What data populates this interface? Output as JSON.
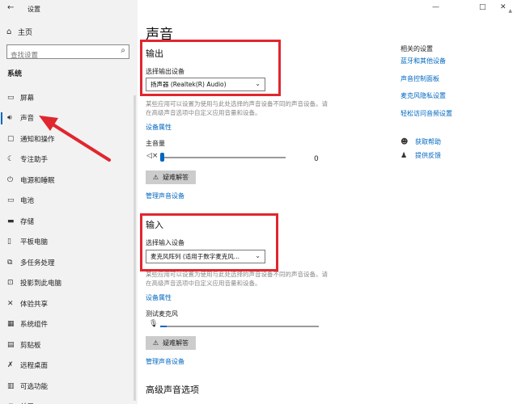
{
  "window": {
    "title": "设置",
    "back_glyph": "←",
    "minimize_glyph": "—",
    "restore_glyph": "□",
    "close_glyph": "✕"
  },
  "sidebar": {
    "home_label": "主页",
    "search_placeholder": "查找设置",
    "section_title": "系统",
    "items": [
      {
        "label": "屏幕",
        "icon": "▭"
      },
      {
        "label": "声音",
        "icon": "🔊︎"
      },
      {
        "label": "通知和操作",
        "icon": "▢"
      },
      {
        "label": "专注助手",
        "icon": "☾"
      },
      {
        "label": "电源和睡眠",
        "icon": "⏻"
      },
      {
        "label": "电池",
        "icon": "▭"
      },
      {
        "label": "存储",
        "icon": "▬"
      },
      {
        "label": "平板电脑",
        "icon": "▯"
      },
      {
        "label": "多任务处理",
        "icon": "⧉"
      },
      {
        "label": "投影到此电脑",
        "icon": "⊡"
      },
      {
        "label": "体验共享",
        "icon": "✕"
      },
      {
        "label": "系统组件",
        "icon": "▦"
      },
      {
        "label": "剪贴板",
        "icon": "▤"
      },
      {
        "label": "远程桌面",
        "icon": "✗"
      },
      {
        "label": "可选功能",
        "icon": "▥"
      },
      {
        "label": "关于",
        "icon": "ⓘ"
      }
    ]
  },
  "main": {
    "page_title": "声音",
    "output": {
      "heading": "输出",
      "select_label": "选择输出设备",
      "device": "扬声器 (Realtek(R) Audio)",
      "desc": "某些应用可以设置为使用与此处选择的声音设备不同的声音设备。请在高级声音选项中自定义应用音量和设备。",
      "device_props": "设备属性",
      "master_volume_label": "主音量",
      "volume_value": "0",
      "troubleshoot": "疑难解答",
      "manage": "管理声音设备"
    },
    "input": {
      "heading": "输入",
      "select_label": "选择输入设备",
      "device": "麦克风阵列 (适用于数字麦克风...",
      "desc": "某些应用可以设置为使用与此处选择的声音设备不同的声音设备。请在高级声音选项中自定义应用音量和设备。",
      "device_props": "设备属性",
      "test_mic_label": "测试麦克风",
      "troubleshoot": "疑难解答",
      "manage": "管理声音设备"
    },
    "advanced_heading": "高级声音选项",
    "related": {
      "title": "相关的设置",
      "links": [
        "蓝牙和其他设备",
        "声音控制面板",
        "麦克风隐私设置",
        "轻松访问音频设置"
      ],
      "help": "获取帮助",
      "feedback": "提供反馈"
    }
  },
  "volume_level": 0,
  "mic_level": 0.04,
  "colors": {
    "accent": "#0067c0",
    "annotation": "#e0262e",
    "sidebar_bg": "#f2f2f2"
  }
}
